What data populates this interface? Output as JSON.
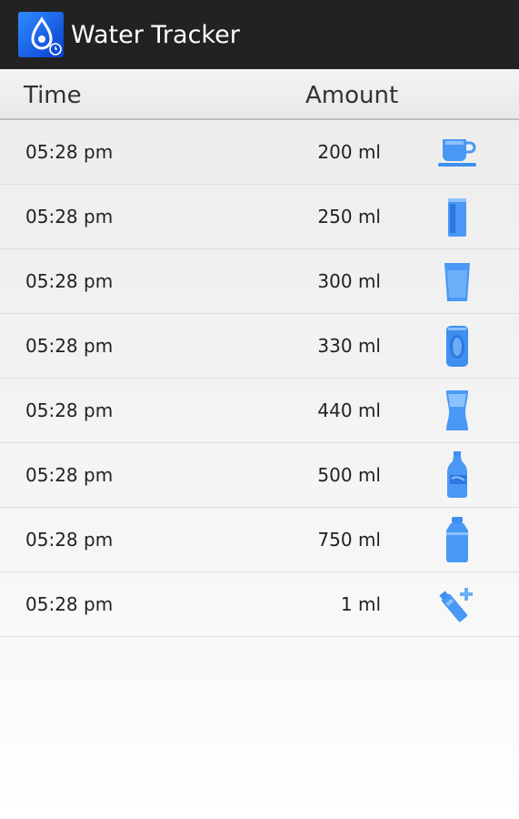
{
  "app": {
    "title": "Water Tracker",
    "icon": "water-drop-clock-icon"
  },
  "header": {
    "time_label": "Time",
    "amount_label": "Amount"
  },
  "colors": {
    "action_bar": "#222222",
    "icon_blue": "#3f8ff0"
  },
  "entries": [
    {
      "time": "05:28 pm",
      "amount": "200 ml",
      "icon": "cup-icon"
    },
    {
      "time": "05:28 pm",
      "amount": "250 ml",
      "icon": "tall-glass-icon"
    },
    {
      "time": "05:28 pm",
      "amount": "300 ml",
      "icon": "glass-icon"
    },
    {
      "time": "05:28 pm",
      "amount": "330 ml",
      "icon": "can-icon"
    },
    {
      "time": "05:28 pm",
      "amount": "440 ml",
      "icon": "pint-glass-icon"
    },
    {
      "time": "05:28 pm",
      "amount": "500 ml",
      "icon": "soda-bottle-icon"
    },
    {
      "time": "05:28 pm",
      "amount": "750 ml",
      "icon": "water-bottle-icon"
    },
    {
      "time": "05:28 pm",
      "amount": "1 ml",
      "icon": "custom-add-icon"
    }
  ]
}
